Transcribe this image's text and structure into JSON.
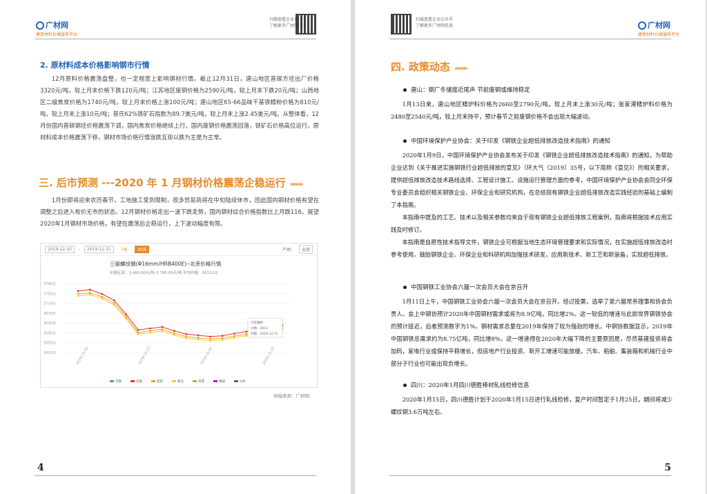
{
  "header": {
    "logo_text": "广材网",
    "logo_sub": "建筑材料价格服务平台",
    "qr_caption_line1": "扫描查看企业公众号",
    "qr_caption_line2": "了解更多广材网信息"
  },
  "left_page": {
    "subheading": "2. 原材料成本价格影响钢市行情",
    "para1": "12月原料价格震荡盘整，也一定程度上影响钢材行情。截止12月31日，唐山地区普碳方坯出厂价格3320元/吨，较上月末价格下跌120元/吨；江苏地区废钢价格为2590元/吨，较上月末下跌20元/吨；山西地区二级焦炭价格为1740元/吨，较上月末价格上涨100元/吨；唐山地区65-66品味干基铁精粉价格为810元/吨，较上月末上涨10元/吨；普氏62%铁矿石指数为89.7美元/吨，较上月末上涨2.45美元/吨。从整体看，12月份国内普碳钢坯价格震荡下调，国内焦炭价格继续上行，国内废钢价格震荡回落，铁矿石价格高位运行。原材料成本价格震荡下移，钢材市场价格行情涨跌互现以跌为主是为主常。",
    "section_title": "三. 后市预测 ---2020 年 1 月钢材价格震荡企稳运行",
    "para2": "1月份即将迎来农历春节，工地施工受到限制，很多贸易商将在中旬陆续休市，因此国内钢材价格有望在调整之后进入有价无市的状态。12月钢材价格走出一波下跌走势，国内钢材综合价格指数比上月跌116。展望2020年1月钢材市场价格，有望在震荡后企稳运行，上下波动幅度有限。",
    "chart_source": "供稿来源：广材网",
    "page_number": "4",
    "chart_toolbar": {
      "date_from": "2019-12-10",
      "date_to": "2019-12-31",
      "btn_7": "7天",
      "btn_30": "30天",
      "label_region": "产地：",
      "region_value": "全部"
    }
  },
  "chart_data": {
    "type": "line",
    "title": "三级螺纹钢(Φ16mm/HRB400E)--北京价格行情",
    "subtitle": "价格区间：3,480.00元/吨-3,780.00元/吨  平均价格：3612.03",
    "ylim": [
      3510,
      3790
    ],
    "yticks": [
      "3790元",
      "3750元",
      "3710元",
      "3670元",
      "3630元",
      "3590元",
      "3550元",
      "3510元"
    ],
    "x": [
      "2019-12-10",
      "2019-12-15",
      "2019-12-20",
      "2019-12-25"
    ],
    "tooltip": {
      "line1": "汽车钢材",
      "line2": "价格：3612",
      "line3": "日期：2019-12-31"
    },
    "legend": [
      "河钢",
      "首钢",
      "亚新",
      "敬业",
      "津西",
      "钢研",
      "分析"
    ],
    "series": [
      {
        "name": "河钢",
        "color": "#e8302a",
        "values": [
          3760,
          3765,
          3748,
          3722,
          3665,
          3602,
          3608,
          3614,
          3598,
          3585,
          3580,
          3575,
          3578,
          3587,
          3595,
          3608,
          3618,
          3622
        ]
      },
      {
        "name": "首钢",
        "color": "#f0a030",
        "values": [
          3748,
          3752,
          3736,
          3711,
          3655,
          3592,
          3598,
          3604,
          3588,
          3575,
          3570,
          3565,
          3568,
          3577,
          3585,
          3598,
          3608,
          3612
        ]
      },
      {
        "name": "亚新",
        "color": "#f2cc33",
        "values": [
          3740,
          3745,
          3729,
          3703,
          3648,
          3585,
          3591,
          3597,
          3581,
          3568,
          3563,
          3558,
          3561,
          3570,
          3578,
          3591,
          3601,
          3605
        ]
      }
    ]
  },
  "right_page": {
    "section_title": "四. 政策动态",
    "item1_title": "唐山：钢厂冬储接近尾声 节前废钢或维持稳定",
    "item1_para": "1月13日来，唐山地区精炉料价格为2660至2790元/吨，较上月末上涨30元/吨；张家港精炉料价格为2480至2540元/吨，较上月末持平，预计春节之前废钢价格不会出现大幅波动。",
    "item2_title": "中国环境保护产业协会：关于印发《钢铁企业超低排放改造技术指南》的通知",
    "item2_para1": "2020年1月9日，中国环境保护产业协会发布关于印发《钢铁企业超低排放改造技术指南》的通知，为帮助企业达到《关于推进实施钢铁行业超低排放的意见》（环大气〔2019〕35号，以下简称《意见》）的相关要求，提供超低排放改造技术路线选择、工程设计施工、设施运行管理方面的参考，中国环境保护产业协会会同全环保专业委员会组织相关钢铁企业、环保企业和研究机构，在总结现有钢铁企业超低排放改造实践经验的基础上编制了本指南。",
    "item2_para2": "本指南中提及的工艺、技术以及相关参数均来自于现有钢铁企业超低排放工程案例，指南将根据技术应用实践及时修订。",
    "item2_para3": "本指南是自愿性技术指导文件，钢铁企业可根据当地生态环境管理要求和实际情况，在实施超低排放改造时参考使用。鼓励钢铁企业、环保企业和科研机构加强技术研发，应用新技术、新工艺和新装备，实现超低排放。",
    "item3_title": "中国钢铁工业协会六届一次会员大会在京召开",
    "item3_para": "1月11日上午，中国钢铁工业协会六届一次会员大会在京召开。经过投票，选举了第六届常务理事和协会负责人。会上中钢协预计2020年中国钢材需求或将为8.9亿吨，同比增2%。这一较低的增速与此前世界钢铁协会的预计接近，后者预测数字为1%。钢材需求总量在2019年保持了较为强劲的增长。中钢协数据显示，2019年中国钢铁总需求约为8.75亿吨，同比增8%。这一增速得在2020年大幅下降的主要原因是，尽然基建投资将会加码，家电行业或保持平稳增长，但房地产行业投资、新开工增速可能放缓，汽车、船舶、集装箱和机械行业中部分子行业也可能出现负增长。",
    "item4_title": "四川：2020年1月四川德胜棒材轧线检修信息",
    "item4_para": "2020年1月15日，四川德胜计划于2020年1月15日进行轧线检修，复产时间暂定于1月25日，期间将减少螺纹钢3.6万吨左右。",
    "page_number": "5"
  }
}
